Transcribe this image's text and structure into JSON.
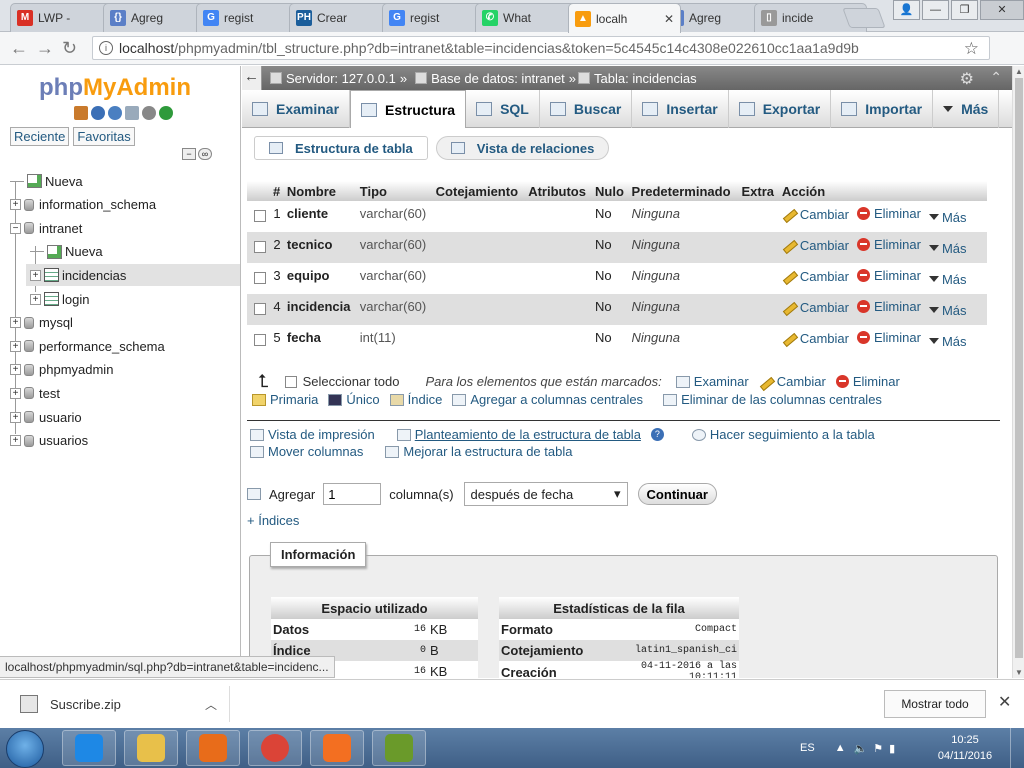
{
  "browser": {
    "tabs": [
      {
        "title": "LWP -",
        "icon": "gmail-icon",
        "color": "#d93025",
        "glyph": "M",
        "active": false
      },
      {
        "title": "Agreg",
        "icon": "braces-icon",
        "color": "#5b7fc7",
        "glyph": "{}",
        "active": false
      },
      {
        "title": "regist",
        "icon": "google-icon",
        "color": "#4285f4",
        "glyph": "G",
        "active": false
      },
      {
        "title": "Crear",
        "icon": "ph-icon",
        "color": "#1b5e9b",
        "glyph": "PH",
        "active": false
      },
      {
        "title": "regist",
        "icon": "google-icon",
        "color": "#4285f4",
        "glyph": "G",
        "active": false
      },
      {
        "title": "What",
        "icon": "whatsapp-icon",
        "color": "#25d366",
        "glyph": "✆",
        "active": false
      },
      {
        "title": "localh",
        "icon": "pma-icon",
        "color": "#f89c0e",
        "glyph": "▲",
        "active": true
      },
      {
        "title": "Agreg",
        "icon": "braces-icon",
        "color": "#5b7fc7",
        "glyph": "{}",
        "active": false
      },
      {
        "title": "incide",
        "icon": "document-icon",
        "color": "#999999",
        "glyph": "▯",
        "active": false
      }
    ],
    "window_controls": {
      "user": "👤",
      "minimize": "—",
      "restore": "❐",
      "close": "✕"
    },
    "url_host": "localhost",
    "url_path": "/phpmyadmin/tbl_structure.php?db=intranet&table=incidencias&token=5c4545c14c4308e022610cc1aa1a9d9b"
  },
  "sidebar": {
    "logo_php": "php",
    "logo_my": "MyAdmin",
    "tabs": [
      "Reciente",
      "Favoritas"
    ],
    "tree": [
      {
        "label": "Nueva",
        "level": 0,
        "expander": "",
        "icon": "new-db-icon",
        "selected": false
      },
      {
        "label": "information_schema",
        "level": 0,
        "expander": "+",
        "icon": "database-icon",
        "selected": false
      },
      {
        "label": "intranet",
        "level": 0,
        "expander": "−",
        "icon": "database-icon",
        "selected": false
      },
      {
        "label": "Nueva",
        "level": 1,
        "expander": "",
        "icon": "new-table-icon",
        "selected": false
      },
      {
        "label": "incidencias",
        "level": 1,
        "expander": "+",
        "icon": "table-icon",
        "selected": true
      },
      {
        "label": "login",
        "level": 1,
        "expander": "+",
        "icon": "table-icon",
        "selected": false
      },
      {
        "label": "mysql",
        "level": 0,
        "expander": "+",
        "icon": "database-icon",
        "selected": false
      },
      {
        "label": "performance_schema",
        "level": 0,
        "expander": "+",
        "icon": "database-icon",
        "selected": false
      },
      {
        "label": "phpmyadmin",
        "level": 0,
        "expander": "+",
        "icon": "database-icon",
        "selected": false
      },
      {
        "label": "test",
        "level": 0,
        "expander": "+",
        "icon": "database-icon",
        "selected": false
      },
      {
        "label": "usuario",
        "level": 0,
        "expander": "+",
        "icon": "database-icon",
        "selected": false
      },
      {
        "label": "usuarios",
        "level": 0,
        "expander": "+",
        "icon": "database-icon",
        "selected": false
      }
    ]
  },
  "breadcrumb": {
    "server": "Servidor: 127.0.0.1",
    "database": "Base de datos: intranet",
    "table": "Tabla: incidencias",
    "sep": "»"
  },
  "menu": [
    {
      "label": "Examinar",
      "active": false
    },
    {
      "label": "Estructura",
      "active": true
    },
    {
      "label": "SQL",
      "active": false
    },
    {
      "label": "Buscar",
      "active": false
    },
    {
      "label": "Insertar",
      "active": false
    },
    {
      "label": "Exportar",
      "active": false
    },
    {
      "label": "Importar",
      "active": false
    },
    {
      "label": "Más",
      "active": false
    }
  ],
  "subtabs": [
    "Estructura de tabla",
    "Vista de relaciones"
  ],
  "table": {
    "headers": [
      "",
      "#",
      "Nombre",
      "Tipo",
      "Cotejamiento",
      "Atributos",
      "Nulo",
      "Predeterminado",
      "Extra",
      "Acción"
    ],
    "rows": [
      {
        "num": "1",
        "name": "cliente",
        "type": "varchar(60)",
        "collation": "",
        "attributes": "",
        "null": "No",
        "default": "Ninguna",
        "extra": ""
      },
      {
        "num": "2",
        "name": "tecnico",
        "type": "varchar(60)",
        "collation": "",
        "attributes": "",
        "null": "No",
        "default": "Ninguna",
        "extra": ""
      },
      {
        "num": "3",
        "name": "equipo",
        "type": "varchar(60)",
        "collation": "",
        "attributes": "",
        "null": "No",
        "default": "Ninguna",
        "extra": ""
      },
      {
        "num": "4",
        "name": "incidencia",
        "type": "varchar(60)",
        "collation": "",
        "attributes": "",
        "null": "No",
        "default": "Ninguna",
        "extra": ""
      },
      {
        "num": "5",
        "name": "fecha",
        "type": "int(11)",
        "collation": "",
        "attributes": "",
        "null": "No",
        "default": "Ninguna",
        "extra": ""
      }
    ],
    "actions": {
      "change": "Cambiar",
      "drop": "Eliminar",
      "more": "Más"
    }
  },
  "bulk": {
    "arrow": "⮤",
    "select_all": "Seleccionar todo",
    "with_selected": "Para los elementos que están marcados:",
    "browse": "Examinar",
    "change": "Cambiar",
    "drop": "Eliminar",
    "primary": "Primaria",
    "unique": "Único",
    "index": "Índice",
    "add_central": "Agregar a columnas centrales",
    "remove_central": "Eliminar de las columnas centrales"
  },
  "links": {
    "print": "Vista de impresión",
    "propose": "Planteamiento de la estructura de tabla",
    "track": "Hacer seguimiento a la tabla",
    "move": "Mover columnas",
    "improve": "Mejorar la estructura de tabla"
  },
  "add_columns": {
    "label": "Agregar",
    "value": "1",
    "unit": "columna(s)",
    "after": "después de fecha",
    "button": "Continuar"
  },
  "indices_toggle": "+ Índices",
  "info": {
    "legend": "Información",
    "space_title": "Espacio utilizado",
    "space_rows": [
      {
        "label": "Datos",
        "value": "16",
        "unit": "KB"
      },
      {
        "label": "Índice",
        "value": "0",
        "unit": "B"
      },
      {
        "label": "",
        "value": "16",
        "unit": "KB"
      }
    ],
    "stats_title": "Estadísticas de la fila",
    "stats_rows": [
      {
        "label": "Formato",
        "value": "Compact"
      },
      {
        "label": "Cotejamiento",
        "value": "latin1_spanish_ci"
      },
      {
        "label": "Creación",
        "value": "04-11-2016 a las 10:11:11"
      }
    ]
  },
  "status_url": "localhost/phpmyadmin/sql.php?db=intranet&table=incidenc...",
  "download": {
    "filename": "Suscribe.zip",
    "show_all": "Mostrar todo"
  },
  "taskbar": {
    "apps": [
      {
        "icon": "ie-icon",
        "color": "#1e88e5"
      },
      {
        "icon": "explorer-icon",
        "color": "#e8c04a"
      },
      {
        "icon": "media-player-icon",
        "color": "#e86c1a"
      },
      {
        "icon": "chrome-icon",
        "color": "#db4437"
      },
      {
        "icon": "xampp-icon",
        "color": "#f36f21"
      },
      {
        "icon": "editor-icon",
        "color": "#6a9a2a"
      }
    ],
    "lang": "ES",
    "time": "10:25",
    "date": "04/11/2016"
  },
  "colors": {
    "link": "#235a81",
    "accent": "#f89c0e",
    "php_blue": "#6c7eb7",
    "drop_red": "#d9362a"
  }
}
